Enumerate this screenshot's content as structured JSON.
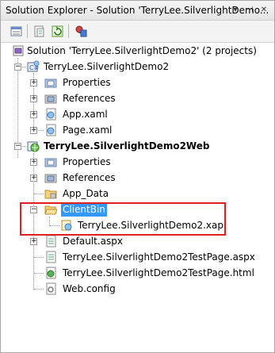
{
  "window": {
    "title": "Solution Explorer - Solution 'TerryLee.SilverlightDemo...",
    "buttons": {
      "dropdown": "▾",
      "pin": "⊣",
      "close": "✕"
    }
  },
  "toolbar": {
    "icons": [
      "properties-icon",
      "show-all-files-icon",
      "refresh-icon",
      "class-diagram-icon"
    ]
  },
  "tree": {
    "solution": "Solution 'TerryLee.SilverlightDemo2' (2 projects)",
    "project1": {
      "name": "TerryLee.SilverlightDemo2",
      "items": [
        "Properties",
        "References",
        "App.xaml",
        "Page.xaml"
      ]
    },
    "project2": {
      "name": "TerryLee.SilverlightDemo2Web",
      "items": [
        "Properties",
        "References",
        "App_Data"
      ],
      "clientbin": "ClientBin",
      "xap": "TerryLee.SilverlightDemo2.xap",
      "files": [
        "Default.aspx",
        "TerryLee.SilverlightDemo2TestPage.aspx",
        "TerryLee.SilverlightDemo2TestPage.html",
        "Web.config"
      ]
    }
  },
  "colors": {
    "selection": "#3399ff",
    "highlight_box": "#e02020"
  }
}
